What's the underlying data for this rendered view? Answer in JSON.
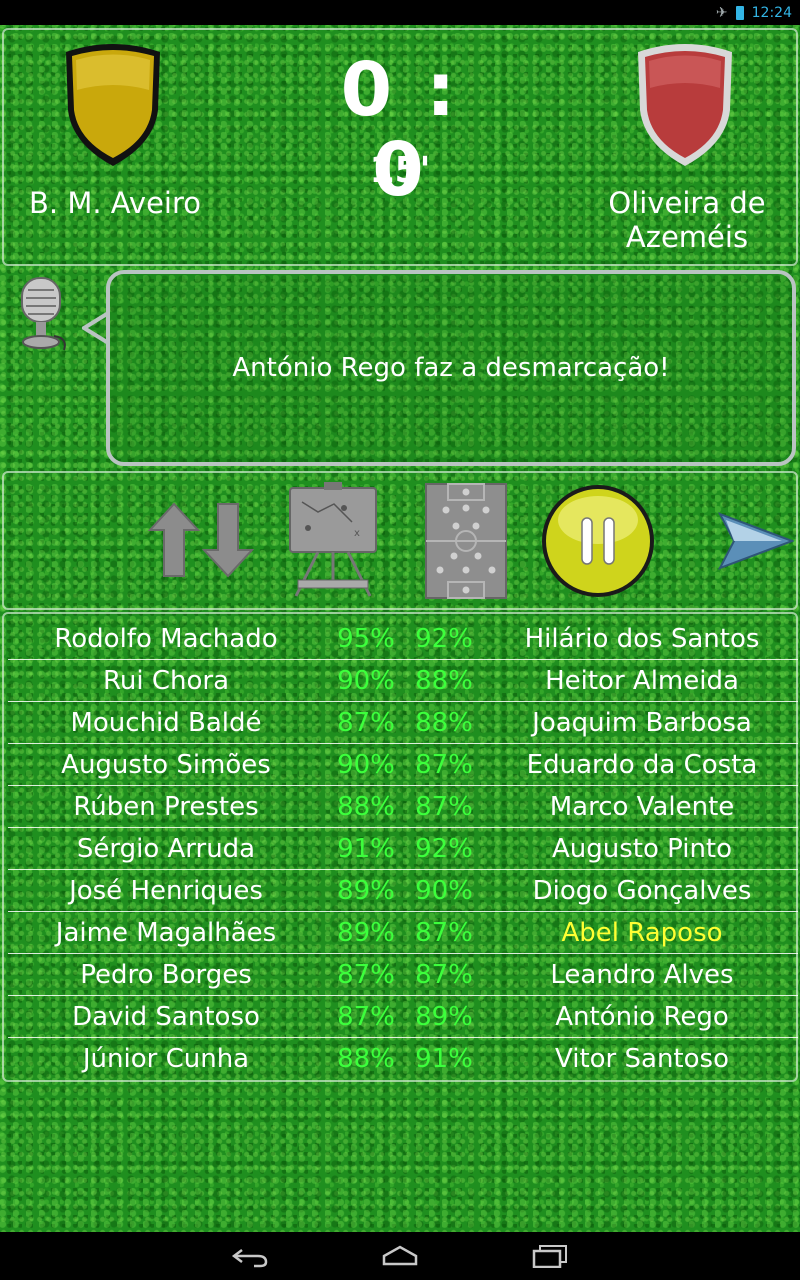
{
  "status_bar": {
    "time": "12:24",
    "icons": [
      "airplane-icon",
      "battery-icon"
    ]
  },
  "match": {
    "home_team": "B. M. Aveiro",
    "away_team": "Oliveira de Azeméis",
    "score": "0 : 0",
    "minute": "15'",
    "home_crest_color": "#c9a80c",
    "away_crest_color": "#b83c3c"
  },
  "commentary": {
    "text": "António Rego faz a desmarcação!"
  },
  "controls": {
    "icons": [
      "substitutions-icon",
      "tactics-board-icon",
      "formation-icon",
      "pause-icon",
      "next-arrow-icon"
    ]
  },
  "players": [
    {
      "home": "Rodolfo Machado",
      "home_pct": "95%",
      "away_pct": "92%",
      "away": "Hilário dos Santos"
    },
    {
      "home": "Rui Chora",
      "home_pct": "90%",
      "away_pct": "88%",
      "away": "Heitor Almeida"
    },
    {
      "home": "Mouchid Baldé",
      "home_pct": "87%",
      "away_pct": "88%",
      "away": "Joaquim Barbosa"
    },
    {
      "home": "Augusto Simões",
      "home_pct": "90%",
      "away_pct": "87%",
      "away": "Eduardo da Costa"
    },
    {
      "home": "Rúben Prestes",
      "home_pct": "88%",
      "away_pct": "87%",
      "away": "Marco Valente"
    },
    {
      "home": "Sérgio Arruda",
      "home_pct": "91%",
      "away_pct": "92%",
      "away": "Augusto Pinto"
    },
    {
      "home": "José Henriques",
      "home_pct": "89%",
      "away_pct": "90%",
      "away": "Diogo Gonçalves"
    },
    {
      "home": "Jaime Magalhães",
      "home_pct": "89%",
      "away_pct": "87%",
      "away": "Abel Raposo"
    },
    {
      "home": "Pedro Borges",
      "home_pct": "87%",
      "away_pct": "87%",
      "away": "Leandro Alves"
    },
    {
      "home": "David Santoso",
      "home_pct": "87%",
      "away_pct": "89%",
      "away": "António Rego"
    },
    {
      "home": "Júnior Cunha",
      "home_pct": "88%",
      "away_pct": "91%",
      "away": "Vitor Santoso"
    }
  ],
  "highlighted_player": "Abel Raposo",
  "colors": {
    "pct_green": "#3cff3c",
    "highlight_yellow": "#ffff33"
  },
  "nav_bar": {
    "icons": [
      "back-icon",
      "home-icon",
      "recent-apps-icon"
    ]
  }
}
